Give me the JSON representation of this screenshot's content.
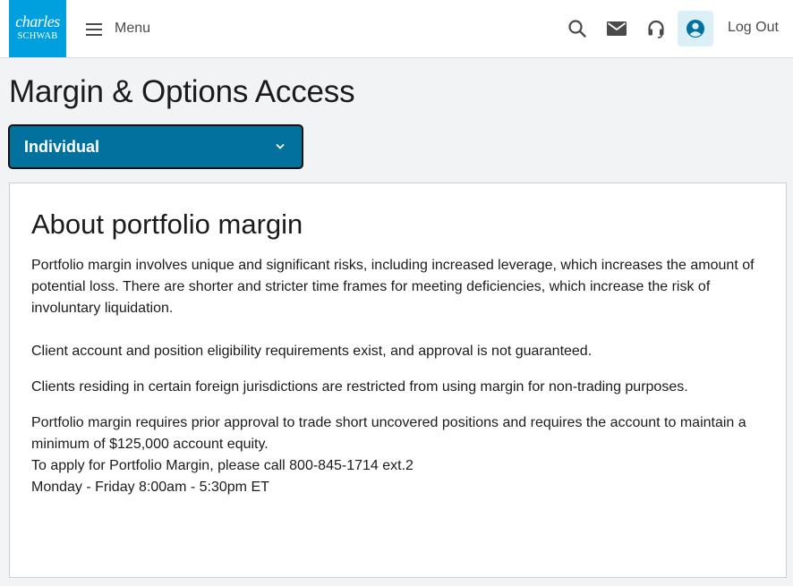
{
  "header": {
    "logo": {
      "line1": "charles",
      "line2": "SCHWAB"
    },
    "menu_label": "Menu",
    "icons": {
      "search": "search-icon",
      "mail": "mail-icon",
      "support": "headset-icon",
      "profile": "user-circle-icon",
      "menu": "hamburger-icon"
    },
    "logout_label": "Log Out"
  },
  "page": {
    "title": "Margin & Options Access",
    "account_select": {
      "value": "Individual"
    }
  },
  "card": {
    "title": "About portfolio margin",
    "paragraphs": [
      "Portfolio margin involves unique and significant risks, including increased leverage, which increases the amount of potential loss. There are shorter and stricter time frames for meeting deficiencies, which increase the risk of involuntary liquidation.",
      "Client account and position eligibility requirements exist, and approval is not guaranteed.",
      "Clients residing in certain foreign jurisdictions are restricted from using margin for non-trading purposes."
    ],
    "apply_lines": [
      "Portfolio margin requires prior approval to trade short uncovered positions and requires the account to maintain a minimum of $125,000 account equity.",
      "To apply for Portfolio Margin, please call 800-845-1714 ext.2",
      "Monday - Friday 8:00am - 5:30pm ET"
    ]
  },
  "colors": {
    "brand_blue": "#00a0df",
    "select_blue": "#02719e",
    "page_bg": "#f2f3f5",
    "avatar_bg": "#dbeff7",
    "profile_icon": "#02719e"
  }
}
